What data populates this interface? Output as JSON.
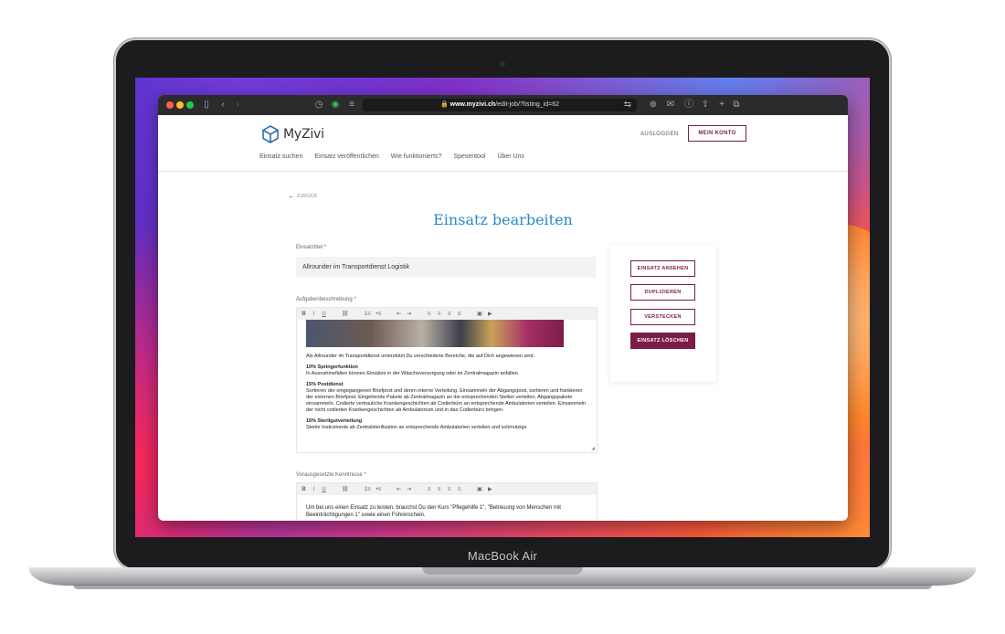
{
  "device": {
    "label": "MacBook Air"
  },
  "browser": {
    "url_host": "www.myzivi.ch",
    "url_path": "/edit-job/?listing_id=62"
  },
  "site": {
    "logo_text": "MyZivi",
    "nav": [
      "Einsatz suchen",
      "Einsatz veröffentlichen",
      "Wie funktionierts?",
      "Spesentool",
      "Über Uns"
    ],
    "logout_label": "AUSLOGGEN",
    "account_label": "MEIN KONTO"
  },
  "page": {
    "back_label": "ZURÜCK",
    "title": "Einsatz bearbeiten",
    "title_field": {
      "label": "Einsatztitel *",
      "value": "Allrounder im Transportdienst Logistik"
    },
    "description": {
      "label": "Aufgabenbeschreibung *",
      "intro": "Als Allrounder im Transportdienst unterstützt Du verschiedene Bereiche, die auf Dich angewiesen sind.",
      "sections": [
        {
          "heading": "10% Springerfunktion",
          "text": "In Ausnahmefällen können Einsätze in der Wäscheversorgung oder im Zentralmagazin anfallen."
        },
        {
          "heading": "15% Postdienst",
          "text": "Sortieren der eingegangenen Briefpost und deren interne Verteilung. Einsammeln der Abgangspost, sortieren und frankieren der externen Briefpost. Eingehende Pakete ab Zentralmagazin an die entsprechenden Stellen verteilen, Abgangspakete einsammeln. Codierte vertrauliche Krankengeschichten ab Codierbüro an entsprechende Ambulatorien verteilen. Einsammeln der nicht codierten Krankengeschichten ab Ambulatorium und in das Codierbüro bringen."
        },
        {
          "heading": "15% Sterilgutverteilung",
          "text": "Sterile Instrumente ab Zentralsterilisation an entsprechende Ambulatorien verteilen und schmutzige"
        }
      ]
    },
    "skills": {
      "label": "Vorausgesetzte Kenntnisse *",
      "text": "Um bei uns einen Einsatz zu leisten, brauchst Du den Kurs \"Pflegehilfe 1\", \"Betreuung von Menschen mit Beeinträchtigungen 1\" sowie einen Führerschein."
    },
    "actions": [
      "EINSATZ ANSEHEN",
      "DUPLIZIEREN",
      "VERSTECKEN",
      "EINSATZ LÖSCHEN"
    ]
  },
  "editor_toolbar": [
    "B",
    "I",
    "U",
    "⛓",
    "1≡",
    "•≡",
    "⇤",
    "⇥",
    "≡",
    "≡",
    "≡",
    "≡",
    "▣",
    "▶"
  ],
  "colors": {
    "accent": "#7a1d4a",
    "title": "#2b8ac9"
  }
}
